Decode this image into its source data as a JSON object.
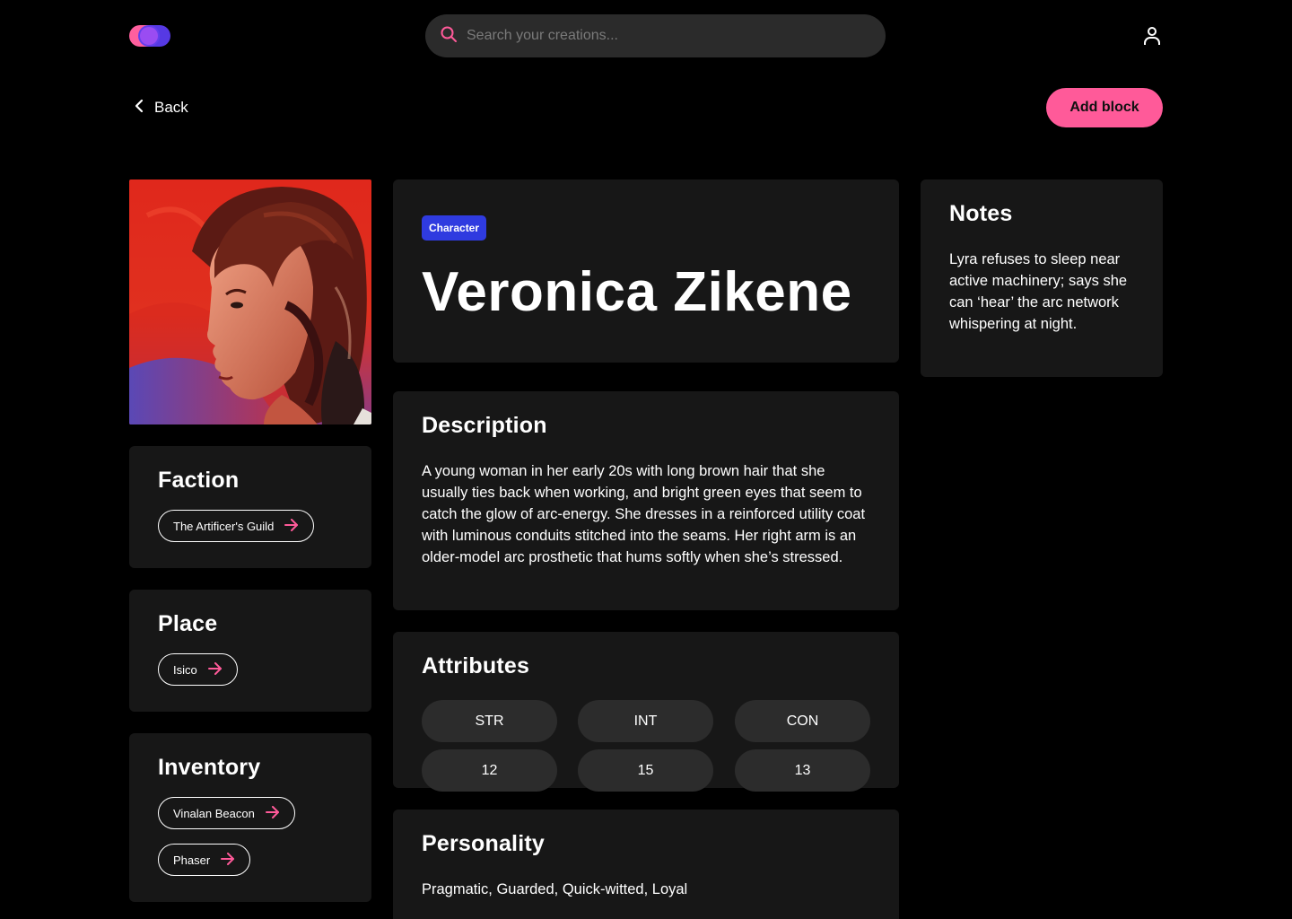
{
  "header": {
    "search_placeholder": "Search your creations...",
    "logo_name": "logo"
  },
  "nav": {
    "back_label": "Back",
    "add_block_label": "Add block"
  },
  "faction": {
    "title": "Faction",
    "items": [
      "The Artificer's Guild"
    ]
  },
  "place": {
    "title": "Place",
    "items": [
      "Isico"
    ]
  },
  "inventory": {
    "title": "Inventory",
    "items": [
      "Vinalan Beacon",
      "Phaser"
    ]
  },
  "character": {
    "badge": "Character",
    "name": "Veronica Zikene"
  },
  "description": {
    "title": "Description",
    "text": "A young woman in her early 20s with long brown hair that she usually ties back when working, and bright green eyes that seem to catch the glow of arc-energy. She dresses in a reinforced utility coat with luminous conduits stitched into the seams. Her right arm is an older-model arc prosthetic that hums softly when she’s stressed."
  },
  "attributes": {
    "title": "Attributes",
    "labels": [
      "STR",
      "INT",
      "CON"
    ],
    "values": [
      "12",
      "15",
      "13"
    ]
  },
  "personality": {
    "title": "Personality",
    "text": "Pragmatic, Guarded, Quick-witted, Loyal"
  },
  "notes": {
    "title": "Notes",
    "text": "Lyra refuses to sleep near active machinery; says she can ‘hear’ the arc network whispering at night."
  },
  "colors": {
    "accent": "#ff5a99",
    "badge": "#2f3be0",
    "card": "#171717",
    "background": "#000000"
  },
  "icons": [
    "search-icon",
    "user-icon",
    "chevron-left-icon",
    "arrow-right-icon"
  ]
}
